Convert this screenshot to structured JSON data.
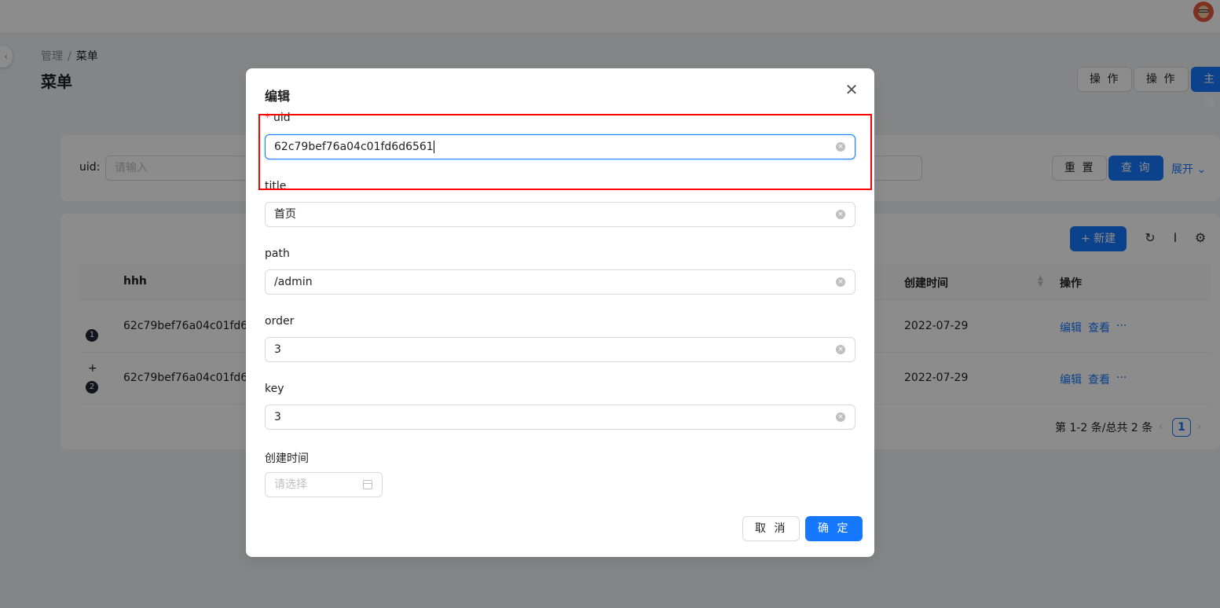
{
  "breadcrumb": {
    "parent": "管理",
    "separator": "/",
    "current": "菜单"
  },
  "page_title": "菜单",
  "header_actions": [
    "操 作",
    "操 作",
    "主操"
  ],
  "search": {
    "uid_label": "uid:",
    "uid_placeholder": "请输入",
    "reset_label": "重 置",
    "query_label": "查 询",
    "expand_label": "展开"
  },
  "toolbar": {
    "new_label": "+ 新建"
  },
  "table": {
    "headers": {
      "col1": "hhh",
      "created": "创建时间",
      "actions": "操作"
    },
    "rows": [
      {
        "num": "1",
        "uid": "62c79bef76a04c01fd6d...",
        "created": "2022-07-29",
        "edit": "编辑",
        "view": "查看",
        "more": "···"
      },
      {
        "num": "2",
        "uid": "62c79bef76a04c01fd6d...",
        "created": "2022-07-29",
        "edit": "编辑",
        "view": "查看",
        "more": "···"
      }
    ],
    "pagination": {
      "summary": "第 1-2 条/总共 2 条",
      "current_page": "1"
    }
  },
  "modal": {
    "title": "编辑",
    "fields": {
      "uid": {
        "label": "uid",
        "value": "62c79bef76a04c01fd6d6561"
      },
      "title": {
        "label": "title",
        "value": "首页"
      },
      "path": {
        "label": "path",
        "value": "/admin"
      },
      "order": {
        "label": "order",
        "value": "3"
      },
      "key": {
        "label": "key",
        "value": "3"
      },
      "created": {
        "label": "创建时间",
        "placeholder": "请选择"
      }
    },
    "cancel_label": "取 消",
    "ok_label": "确 定"
  },
  "colors": {
    "primary": "#1677ff",
    "required": "#ff4d4f",
    "highlight": "#ff0000"
  }
}
